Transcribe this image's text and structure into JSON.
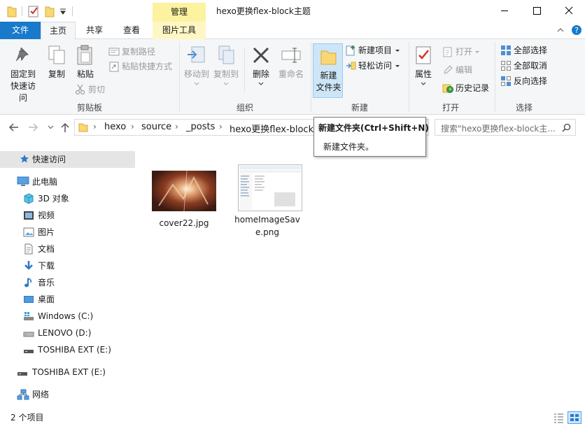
{
  "window": {
    "title": "hexo更换flex-block主题",
    "context_tab_group": "管理"
  },
  "tabs": [
    {
      "label": "文件"
    },
    {
      "label": "主页"
    },
    {
      "label": "共享"
    },
    {
      "label": "查看"
    },
    {
      "label": "图片工具"
    }
  ],
  "ribbon": {
    "clipboard": {
      "pin": "固定到快速访问",
      "copy": "复制",
      "paste": "粘贴",
      "copy_path": "复制路径",
      "paste_shortcut": "粘贴快捷方式",
      "cut": "剪切",
      "label": "剪贴板"
    },
    "organize": {
      "move_to": "移动到",
      "copy_to": "复制到",
      "delete": "删除",
      "rename": "重命名",
      "label": "组织"
    },
    "new": {
      "new_folder_line1": "新建",
      "new_folder_line2": "文件夹",
      "new_item": "新建项目",
      "easy_access": "轻松访问",
      "label": "新建"
    },
    "open": {
      "properties": "属性",
      "open": "打开",
      "edit": "编辑",
      "history": "历史记录",
      "label": "打开"
    },
    "select": {
      "select_all": "全部选择",
      "select_none": "全部取消",
      "invert": "反向选择",
      "label": "选择"
    }
  },
  "address": {
    "crumbs": [
      "hexo",
      "source",
      "_posts",
      "hexo更换flex-block主"
    ]
  },
  "search": {
    "placeholder": "搜索\"hexo更换flex-block主..."
  },
  "tooltip": {
    "title": "新建文件夹(Ctrl+Shift+N)",
    "description": "新建文件夹。"
  },
  "sidebar": {
    "items": [
      {
        "label": "快速访问",
        "icon": "star-icon"
      },
      {
        "label": "此电脑",
        "icon": "computer-icon"
      },
      {
        "label": "3D 对象",
        "icon": "cube-icon"
      },
      {
        "label": "视频",
        "icon": "video-icon"
      },
      {
        "label": "图片",
        "icon": "pictures-icon"
      },
      {
        "label": "文档",
        "icon": "document-icon"
      },
      {
        "label": "下载",
        "icon": "download-icon"
      },
      {
        "label": "音乐",
        "icon": "music-icon"
      },
      {
        "label": "桌面",
        "icon": "desktop-icon"
      },
      {
        "label": "Windows (C:)",
        "icon": "drive-icon"
      },
      {
        "label": "LENOVO (D:)",
        "icon": "drive-icon"
      },
      {
        "label": "TOSHIBA EXT (E:)",
        "icon": "usb-drive-icon"
      },
      {
        "label": "TOSHIBA EXT (E:)",
        "icon": "usb-drive-icon"
      },
      {
        "label": "网络",
        "icon": "network-icon"
      }
    ]
  },
  "files": [
    {
      "name": "cover22.jpg"
    },
    {
      "name": "homeImageSave.png"
    }
  ],
  "status": {
    "item_count": "2 个项目"
  },
  "colors": {
    "accent": "#1979ca",
    "selection": "#cce8ff",
    "context_tab": "#fcf2a0"
  }
}
